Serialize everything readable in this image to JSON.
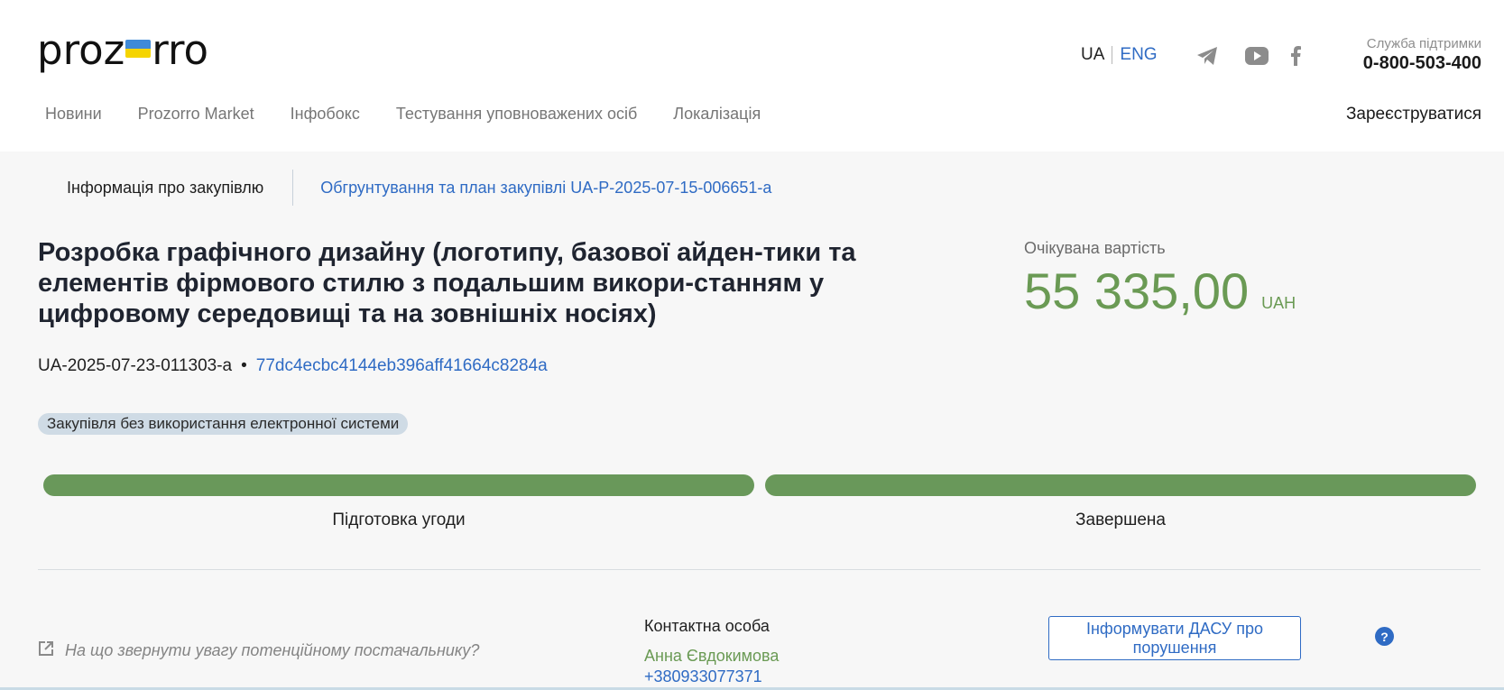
{
  "header": {
    "logo_left": "proz",
    "logo_right": "rro",
    "lang_ua": "UA",
    "lang_eng": "ENG",
    "support_label": "Служба підтримки",
    "support_phone": "0-800-503-400",
    "register": "Зареєструватися",
    "nav": [
      "Новини",
      "Prozorro Market",
      "Інфобокс",
      "Тестування уповноважених осіб",
      "Локалізація"
    ],
    "social_icons": [
      "telegram-icon",
      "youtube-icon",
      "facebook-icon"
    ]
  },
  "tabs": {
    "info": "Інформація про закупівлю",
    "plan": "Обгрунтування та план закупівлі UA-P-2025-07-15-006651-a"
  },
  "tender": {
    "title": "Розробка графічного дизайну (логотипу, базової айден-тики та елементів фірмового стилю з подальшим викори-станням у цифровому середовищі та на зовнішніх носіях)",
    "id": "UA-2025-07-23-011303-a",
    "separator": "•",
    "hash": "77dc4ecbc4144eb396aff41664c8284a",
    "badge": "Закупівля без використання електронної системи"
  },
  "value": {
    "label": "Очікувана вартість",
    "amount": "55 335,00",
    "currency": "UAH"
  },
  "stages": [
    {
      "label": "Підготовка угоди",
      "status": "done"
    },
    {
      "label": "Завершена",
      "status": "done"
    }
  ],
  "footer": {
    "attention": "На що звернути увагу потенційному постачальнику?",
    "contact_label": "Контактна особа",
    "contact_name": "Анна Євдокимова",
    "contact_phone": "+380933077371",
    "report_button": "Інформувати ДАСУ про порушення",
    "help": "?"
  },
  "colors": {
    "accent_blue": "#2f6bc4",
    "accent_green": "#69985a",
    "background": "#f7f7f7"
  }
}
